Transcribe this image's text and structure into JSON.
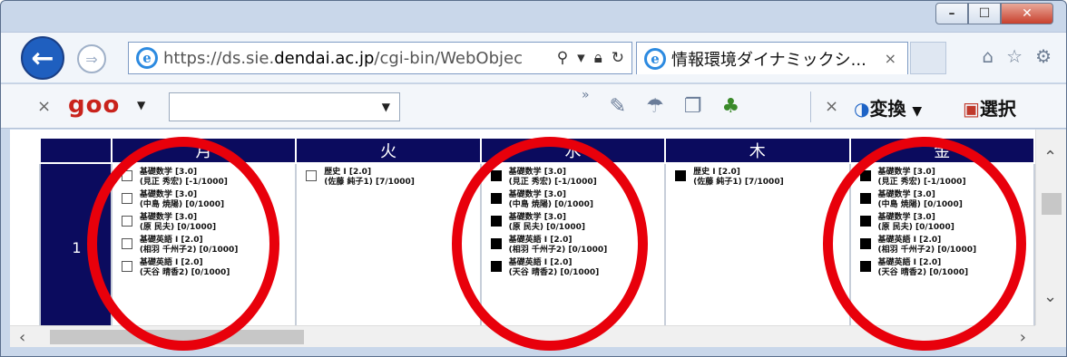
{
  "browser": {
    "url_prefix": "https://ds.sie.",
    "url_domain": "dendai.ac.jp",
    "url_suffix": "/cgi-bin/WebObjec",
    "tab_title": "情報環境ダイナミックシ...",
    "tab_close": "×"
  },
  "goo": {
    "close": "×",
    "logo": "goo",
    "dropdown_arrow": "▼",
    "input_dropdown_arrow": "▼",
    "close2": "×",
    "convert_label": "変換",
    "convert_arrow": "▼",
    "select_label": "選択"
  },
  "timetable": {
    "days": [
      "月",
      "火",
      "水",
      "木",
      "金"
    ],
    "period": "1",
    "cells": [
      [
        {
          "checked": false,
          "title": "基礎数学 [3.0]",
          "detail": "(見正 秀宏) [-1/1000]"
        },
        {
          "checked": false,
          "title": "基礎数学 [3.0]",
          "detail": "(中島 焼陽) [0/1000]"
        },
        {
          "checked": false,
          "title": "基礎数学 [3.0]",
          "detail": "(原 民夫) [0/1000]"
        },
        {
          "checked": false,
          "title": "基礎英語 I [2.0]",
          "detail": "(相羽 千州子2) [0/1000]"
        },
        {
          "checked": false,
          "title": "基礎英語 I [2.0]",
          "detail": "(天谷 晴香2) [0/1000]"
        }
      ],
      [
        {
          "checked": false,
          "title": "歴史 I [2.0]",
          "detail": "(佐藤 純子1) [7/1000]"
        }
      ],
      [
        {
          "checked": true,
          "title": "基礎数学 [3.0]",
          "detail": "(見正 秀宏) [-1/1000]"
        },
        {
          "checked": true,
          "title": "基礎数学 [3.0]",
          "detail": "(中島 焼陽) [0/1000]"
        },
        {
          "checked": true,
          "title": "基礎数学 [3.0]",
          "detail": "(原 民夫) [0/1000]"
        },
        {
          "checked": true,
          "title": "基礎英語 I [2.0]",
          "detail": "(相羽 千州子2) [0/1000]"
        },
        {
          "checked": true,
          "title": "基礎英語 I [2.0]",
          "detail": "(天谷 晴香2) [0/1000]"
        }
      ],
      [
        {
          "checked": true,
          "title": "歴史 I [2.0]",
          "detail": "(佐藤 純子1) [7/1000]"
        }
      ],
      [
        {
          "checked": true,
          "title": "基礎数学 [3.0]",
          "detail": "(見正 秀宏) [-1/1000]"
        },
        {
          "checked": true,
          "title": "基礎数学 [3.0]",
          "detail": "(中島 焼陽) [0/1000]"
        },
        {
          "checked": true,
          "title": "基礎数学 [3.0]",
          "detail": "(原 民夫) [0/1000]"
        },
        {
          "checked": true,
          "title": "基礎英語 I [2.0]",
          "detail": "(相羽 千州子2) [0/1000]"
        },
        {
          "checked": true,
          "title": "基礎英語 I [2.0]",
          "detail": "(天谷 晴香2) [0/1000]"
        }
      ]
    ]
  },
  "colors": {
    "header_bg": "#0b0b5e",
    "annotation_ring": "#e8000b"
  }
}
